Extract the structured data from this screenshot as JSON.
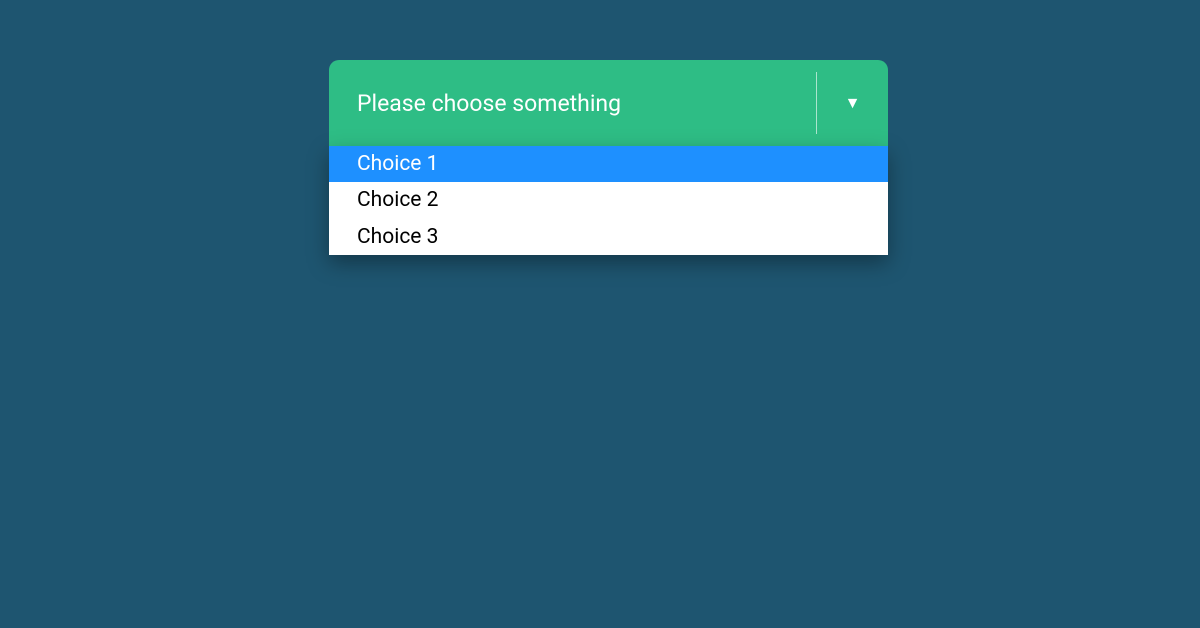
{
  "dropdown": {
    "placeholder": "Please choose something",
    "options": [
      {
        "label": "Choice 1",
        "highlighted": true
      },
      {
        "label": "Choice 2",
        "highlighted": false
      },
      {
        "label": "Choice 3",
        "highlighted": false
      }
    ],
    "arrowGlyph": "▼"
  },
  "colors": {
    "background": "#1e5570",
    "headerBg": "#2ebd85",
    "highlight": "#1e90ff"
  }
}
